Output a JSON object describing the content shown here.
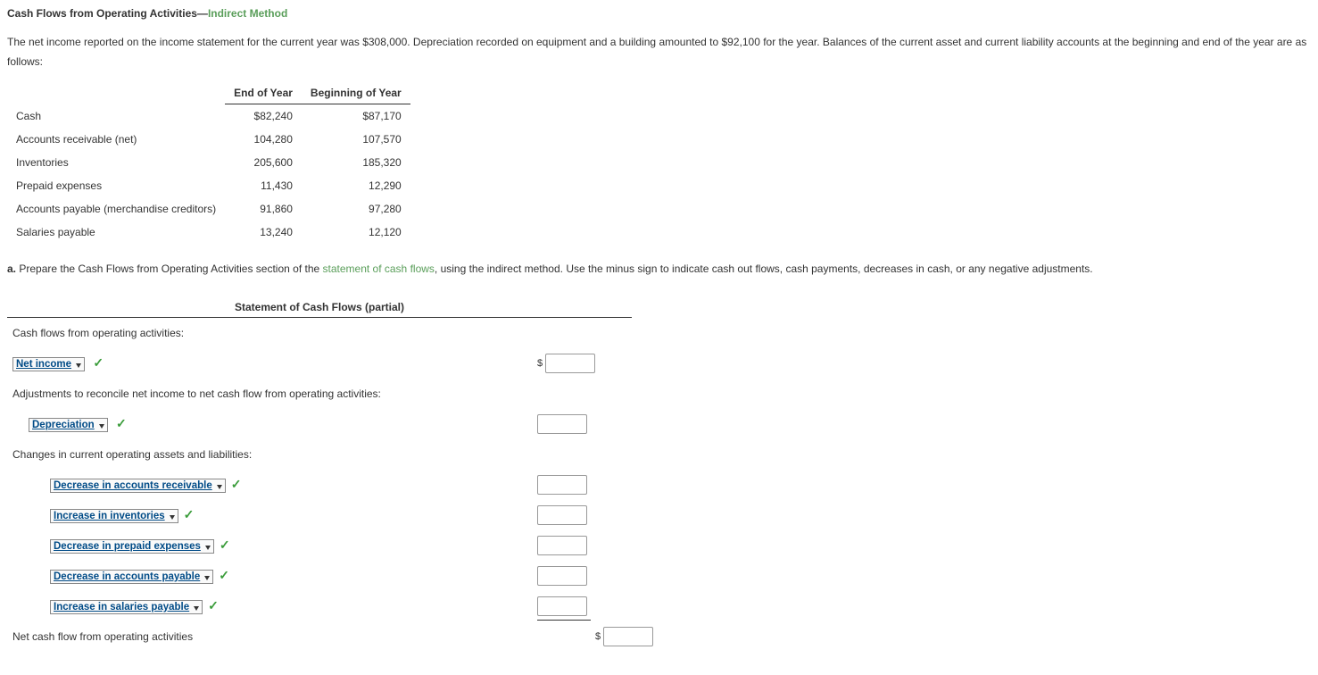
{
  "title": {
    "part1": "Cash Flows from Operating Activities—",
    "part2": "Indirect Method"
  },
  "intro": "The net income reported on the income statement for the current year was $308,000. Depreciation recorded on equipment and a building amounted to $92,100 for the year. Balances of the current asset and current liability accounts at the beginning and end of the year are as follows:",
  "balance": {
    "headers": [
      "",
      "End of Year",
      "Beginning of Year"
    ],
    "rows": [
      {
        "label": "Cash",
        "end": "$82,240",
        "begin": "$87,170"
      },
      {
        "label": "Accounts receivable (net)",
        "end": "104,280",
        "begin": "107,570"
      },
      {
        "label": "Inventories",
        "end": "205,600",
        "begin": "185,320"
      },
      {
        "label": "Prepaid expenses",
        "end": "11,430",
        "begin": "12,290"
      },
      {
        "label": "Accounts payable (merchandise creditors)",
        "end": "91,860",
        "begin": "97,280"
      },
      {
        "label": "Salaries payable",
        "end": "13,240",
        "begin": "12,120"
      }
    ]
  },
  "instruction": {
    "letter": "a.",
    "pre": "  Prepare the Cash Flows from Operating Activities section of the ",
    "link": "statement of cash flows",
    "post": ", using the indirect method. Use the minus sign to indicate cash out flows, cash payments, decreases in cash, or any negative adjustments."
  },
  "worksheet": {
    "title": "Statement of Cash Flows (partial)",
    "heading": "Cash flows from operating activities:",
    "netIncome": "Net income",
    "adjustments": "Adjustments to reconcile net income to net cash flow from operating activities:",
    "depreciation": "Depreciation",
    "changes": "Changes in current operating assets and liabilities:",
    "items": [
      "Decrease in accounts receivable",
      "Increase in inventories",
      "Decrease in prepaid expenses",
      "Decrease in accounts payable",
      "Increase in salaries payable"
    ],
    "netCashFlow": "Net cash flow from operating activities"
  }
}
